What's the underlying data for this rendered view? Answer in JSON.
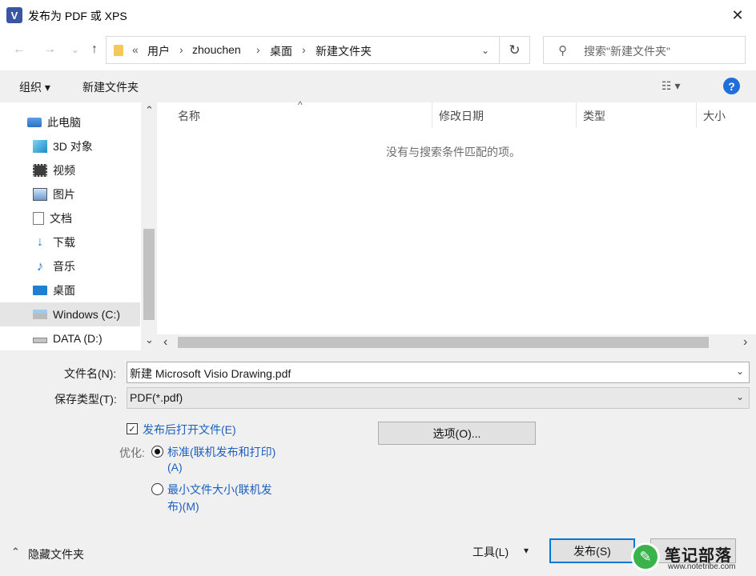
{
  "window": {
    "title": "发布为 PDF 或 XPS",
    "app_icon": "V",
    "close_glyph": "✕"
  },
  "nav": {
    "back_glyph": "←",
    "forward_glyph": "→",
    "recent_glyph": "⌄",
    "up_glyph": "↑",
    "overflow": "«",
    "breadcrumbs": [
      "用户",
      "zhouchen",
      "桌面",
      "新建文件夹"
    ],
    "separator": "›",
    "dropdown_glyph": "⌄",
    "refresh_glyph": "↻",
    "search_placeholder": "搜索\"新建文件夹\"",
    "search_glyph": "⚲"
  },
  "toolbar": {
    "organize_label": "组织 ▾",
    "new_folder_label": "新建文件夹",
    "view_label": "☷ ▾",
    "help_label": "?"
  },
  "sidebar": {
    "items": [
      {
        "label": "此电脑",
        "icon": "computer-icon"
      },
      {
        "label": "3D 对象",
        "icon": "cube-3d-icon"
      },
      {
        "label": "视频",
        "icon": "video-icon"
      },
      {
        "label": "图片",
        "icon": "picture-icon"
      },
      {
        "label": "文档",
        "icon": "document-icon"
      },
      {
        "label": "下载",
        "icon": "download-icon"
      },
      {
        "label": "音乐",
        "icon": "music-icon"
      },
      {
        "label": "桌面",
        "icon": "desktop-icon"
      },
      {
        "label": "Windows (C:)",
        "icon": "windows-drive-icon",
        "selected": true
      },
      {
        "label": "DATA (D:)",
        "icon": "drive-icon"
      }
    ],
    "scroll_up": "⌃",
    "scroll_down": "⌄"
  },
  "file_list": {
    "columns": [
      "名称",
      "修改日期",
      "类型",
      "大小"
    ],
    "sort_indicator": "^",
    "empty_message": "没有与搜索条件匹配的项。",
    "scroll_left": "‹",
    "scroll_right": "›"
  },
  "form": {
    "filename_label": "文件名(N):",
    "filename_value": "新建 Microsoft Visio Drawing.pdf",
    "filetype_label": "保存类型(T):",
    "filetype_value": "PDF(*.pdf)",
    "open_after_label": "发布后打开文件(E)",
    "open_after_checked": true,
    "optimize_label": "优化:",
    "opt_standard_line1": "标准(联机发布和打印)",
    "opt_standard_line2": "(A)",
    "opt_min_line1": "最小文件大小(联机发",
    "opt_min_line2": "布)(M)",
    "options_button": "选项(O)...",
    "dropdown_glyph": "⌄"
  },
  "footer": {
    "hide_folders_label": "隐藏文件夹",
    "hide_glyph": "⌃",
    "tools_label": "工具(L)",
    "tools_glyph": "▾",
    "publish_button": "发布(S)"
  },
  "watermark": {
    "text": "笔记部落",
    "url": "www.notetribe.com"
  },
  "colors": {
    "accent": "#0078d7",
    "link_blue": "#1c5fbf",
    "folder_yellow": "#f3c95a",
    "selected_bg": "#e5e5e5"
  }
}
